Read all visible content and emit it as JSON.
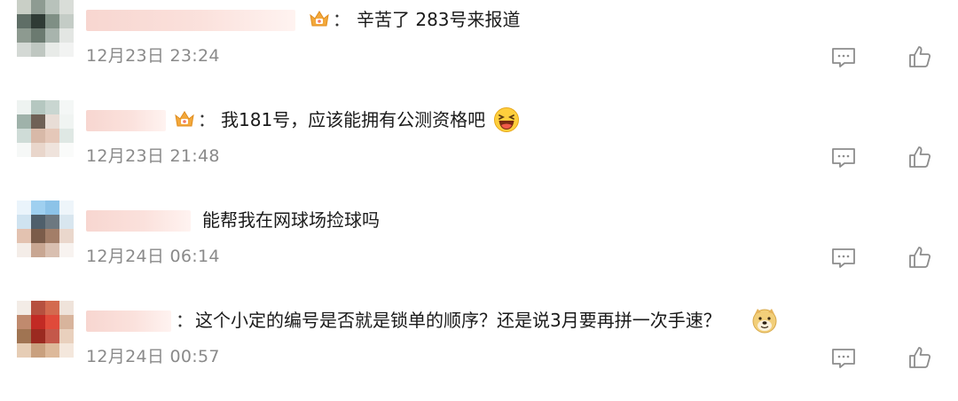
{
  "comments": [
    {
      "text": "辛苦了 283号来报道",
      "time": "12月23日 23:24",
      "separator": "：",
      "has_crown": true,
      "emoji": null,
      "avatar_colors": [
        "#c9cfc6",
        "#8e9b92",
        "#b8c2bb",
        "#d9ddd8",
        "#5f6e66",
        "#2f3b35",
        "#7f8f85",
        "#c4ccc6",
        "#8d9a90",
        "#6b7a70",
        "#a8b4ad",
        "#e3e6e3",
        "#d4d9d5",
        "#bfc7c1",
        "#e8ebe8",
        "#f2f3f2"
      ]
    },
    {
      "text": "我181号，应该能拥有公测资格吧",
      "time": "12月23日 21:48",
      "separator": "：",
      "has_crown": true,
      "emoji": "laugh-emoji",
      "avatar_colors": [
        "#eef3f1",
        "#b5c7c0",
        "#c9d6d1",
        "#f4f7f6",
        "#9fb2aa",
        "#6f6156",
        "#e8ddd6",
        "#f0f4f2",
        "#cfdcd7",
        "#d8b9a8",
        "#e5c8b9",
        "#dfe8e4",
        "#f6f8f7",
        "#e9d6cb",
        "#efe3dc",
        "#fafbfa"
      ]
    },
    {
      "text": "能帮我在网球场捡球吗",
      "time": "12月24日 06:14",
      "separator": "",
      "has_crown": false,
      "emoji": null,
      "avatar_colors": [
        "#eaf4fb",
        "#9fd0f0",
        "#8cc3e8",
        "#eef5fa",
        "#cfe3f0",
        "#4f5f6b",
        "#6d7880",
        "#d8e6ef",
        "#e3c2b0",
        "#7b5c4a",
        "#a37e68",
        "#ead7cc",
        "#f4ede8",
        "#c8a692",
        "#d9bfb0",
        "#f8f3f0"
      ]
    },
    {
      "text": "这个小定的编号是否就是锁单的顺序？还是说3月要再拼一次手速？",
      "time": "12月24日 00:57",
      "separator": "：",
      "has_crown": false,
      "emoji": "doge-emoji",
      "avatar_colors": [
        "#f3ece6",
        "#b6503f",
        "#d36a4f",
        "#efe3da",
        "#c08a6e",
        "#c22a24",
        "#e04a3a",
        "#d8b49c",
        "#a07452",
        "#9b2a20",
        "#c4584a",
        "#e9d0bd",
        "#e6cdb5",
        "#c9a07e",
        "#ddb99a",
        "#f4e7dc"
      ]
    }
  ],
  "colors": {
    "text": "#1a1a1a",
    "time": "#8a8a8a",
    "icon": "#8c8c8c",
    "crown": "#f3a83b"
  }
}
